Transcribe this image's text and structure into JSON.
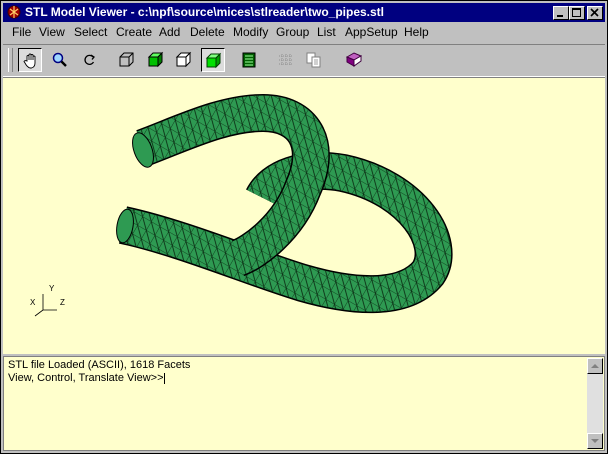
{
  "window": {
    "title": "STL Model Viewer - c:\\npf\\source\\mices\\stlreader\\two_pipes.stl"
  },
  "menu": {
    "items": [
      "File",
      "View",
      "Select",
      "Create",
      "Add",
      "Delete",
      "Modify",
      "Group",
      "List",
      "AppSetup",
      "Help"
    ]
  },
  "toolbar": {
    "tools": [
      "hand-pan-icon",
      "magnifier-zoom-icon",
      "rotate-icon",
      "wireframe-cube-icon",
      "shaded-cube-icon",
      "hidden-line-cube-icon",
      "solid-green-cube-icon",
      "facet-list-icon",
      "grid-icon",
      "copy-icon",
      "book-icon"
    ],
    "pressed": [
      "hand-pan-icon",
      "solid-green-cube-icon"
    ]
  },
  "viewport": {
    "background": "#ffffcc",
    "model_color": "#2e9a52",
    "axes": {
      "x": "X",
      "y": "Y",
      "z": "Z"
    }
  },
  "console": {
    "line1": "STL file Loaded (ASCII), 1618 Facets",
    "line2": "View, Control, Translate View>>"
  },
  "colors": {
    "titlebar": "#000080",
    "face": "#c0c0c0"
  }
}
